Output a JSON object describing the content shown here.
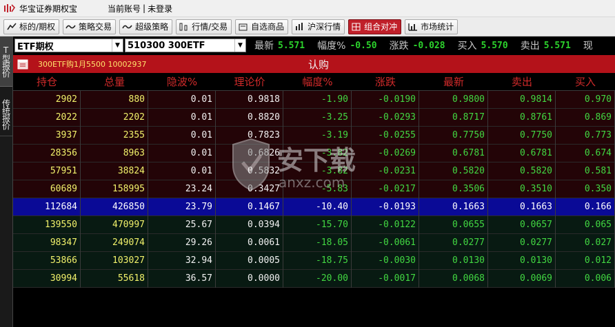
{
  "titlebar": {
    "app_title": "华宝证券期权宝",
    "account_label": "当前账号",
    "separator": "|",
    "login_status": "未登录"
  },
  "toolbar": {
    "buttons": [
      {
        "label": "标的/期权",
        "icon": "candlestick-icon"
      },
      {
        "label": "策略交易",
        "icon": "wave-icon"
      },
      {
        "label": "超级策略",
        "icon": "wave-icon"
      },
      {
        "label": "行情/交易",
        "icon": "chart-icon"
      },
      {
        "label": "自选商品",
        "icon": "favorite-icon"
      },
      {
        "label": "沪深行情",
        "icon": "bar-chart-icon"
      },
      {
        "label": "组合对冲",
        "icon": "combo-icon",
        "active": true
      },
      {
        "label": "市场统计",
        "icon": "stats-icon"
      }
    ]
  },
  "vtabs": {
    "t_quote": "T型报价",
    "traditional_quote": "传统报价"
  },
  "selectors": {
    "category": "ETF期权",
    "underlying": "510300 300ETF"
  },
  "quote": {
    "latest_label": "最新",
    "latest_value": "5.571",
    "change_pct_label": "幅度%",
    "change_pct_value": "-0.50",
    "change_label": "涨跌",
    "change_value": "-0.028",
    "bid_label": "买入",
    "bid_value": "5.570",
    "ask_label": "卖出",
    "ask_value": "5.571",
    "cut_label": "现"
  },
  "contract_bar": {
    "contract_text": "300ETF购1月5500  10002937",
    "side_label": "认购"
  },
  "table": {
    "headers": [
      "持仓",
      "总量",
      "隐波%",
      "理论价",
      "幅度%",
      "涨跌",
      "最新",
      "卖出",
      "买入"
    ],
    "rows": [
      {
        "class": "itm",
        "cells": [
          "2902",
          "880",
          "0.01",
          "0.9818",
          "-1.90",
          "-0.0190",
          "0.9800",
          "0.9814",
          "0.970"
        ]
      },
      {
        "class": "itm",
        "cells": [
          "2022",
          "2202",
          "0.01",
          "0.8820",
          "-3.25",
          "-0.0293",
          "0.8717",
          "0.8761",
          "0.869"
        ]
      },
      {
        "class": "itm",
        "cells": [
          "3937",
          "2355",
          "0.01",
          "0.7823",
          "-3.19",
          "-0.0255",
          "0.7750",
          "0.7750",
          "0.773"
        ]
      },
      {
        "class": "itm",
        "cells": [
          "28356",
          "8963",
          "0.01",
          "0.6826",
          "-3.82",
          "-0.0269",
          "0.6781",
          "0.6781",
          "0.674"
        ]
      },
      {
        "class": "itm",
        "cells": [
          "57951",
          "38824",
          "0.01",
          "0.5832",
          "-3.82",
          "-0.0231",
          "0.5820",
          "0.5820",
          "0.581"
        ]
      },
      {
        "class": "itm",
        "cells": [
          "60689",
          "158995",
          "23.24",
          "0.3427",
          "-5.83",
          "-0.0217",
          "0.3506",
          "0.3510",
          "0.350"
        ]
      },
      {
        "class": "atm",
        "cells": [
          "112684",
          "426850",
          "23.79",
          "0.1467",
          "-10.40",
          "-0.0193",
          "0.1663",
          "0.1663",
          "0.166"
        ]
      },
      {
        "class": "otm",
        "cells": [
          "139550",
          "470997",
          "25.67",
          "0.0394",
          "-15.70",
          "-0.0122",
          "0.0655",
          "0.0657",
          "0.065"
        ]
      },
      {
        "class": "otm",
        "cells": [
          "98347",
          "249074",
          "29.26",
          "0.0061",
          "-18.05",
          "-0.0061",
          "0.0277",
          "0.0277",
          "0.027"
        ]
      },
      {
        "class": "otm",
        "cells": [
          "53866",
          "103027",
          "32.94",
          "0.0005",
          "-18.75",
          "-0.0030",
          "0.0130",
          "0.0130",
          "0.012"
        ]
      },
      {
        "class": "otm",
        "cells": [
          "30994",
          "55618",
          "36.57",
          "0.0000",
          "-20.00",
          "-0.0017",
          "0.0068",
          "0.0069",
          "0.006"
        ]
      }
    ]
  },
  "watermark": {
    "text": "安下载",
    "subtext": "anxz.com"
  },
  "colors": {
    "accent_red": "#b4121a",
    "header_red": "#d02a2a",
    "price_green": "#42d842",
    "volume_yellow": "#f2f26b",
    "atm_blue": "#0a0a96"
  }
}
